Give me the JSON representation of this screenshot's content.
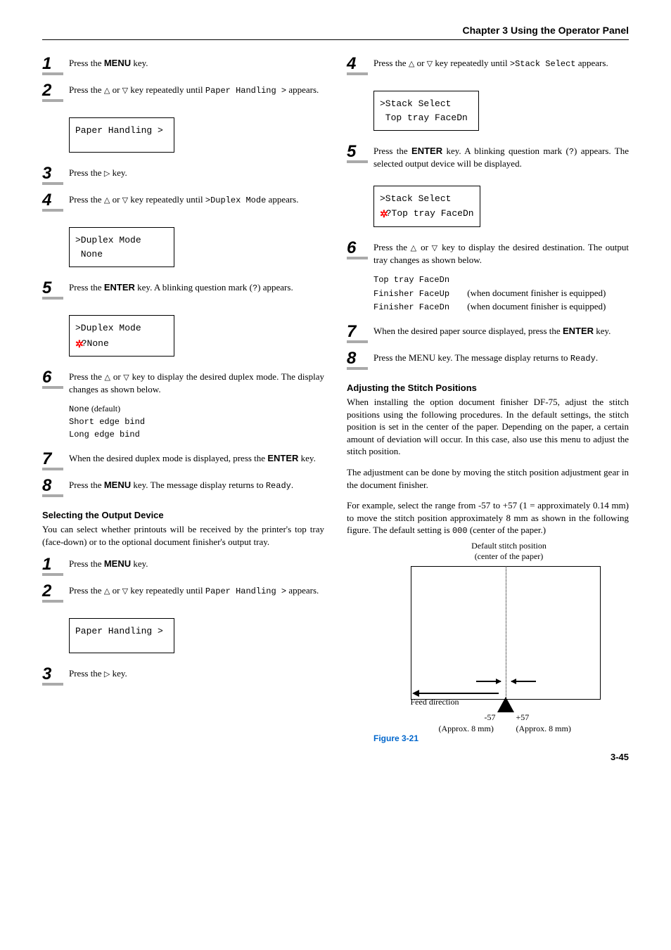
{
  "header": "Chapter 3  Using the Operator Panel",
  "left": {
    "s1": {
      "pre": "Press the ",
      "menu": "MENU",
      "post": " key."
    },
    "s2": {
      "pre": "Press the ",
      "mid": " or ",
      "post": " key repeatedly until ",
      "code": "Paper Handling >",
      "tail": " appears."
    },
    "lcd2": "Paper Handling >",
    "s3": {
      "pre": "Press the ",
      "post": " key."
    },
    "s4": {
      "pre": "Press the ",
      "mid": " or ",
      "post": " key repeatedly until ",
      "code": ">Duplex Mode",
      "tail": " appears."
    },
    "lcd4": ">Duplex Mode\n None",
    "s5": {
      "pre": "Press the ",
      "enter": "ENTER",
      "post": " key. A blinking question mark (",
      "q": "?",
      "tail": ") appears."
    },
    "lcd5_line1": ">Duplex Mode",
    "lcd5_line2": "?None",
    "s6": {
      "pre": "Press the ",
      "mid": " or ",
      "post": " key to display the desired duplex mode. The display changes as shown below."
    },
    "opt_none": "None",
    "opt_none_def": " (default)",
    "opt_short": "Short edge bind",
    "opt_long": "Long edge bind",
    "s7": {
      "pre": "When the desired duplex mode is displayed, press the ",
      "enter": "ENTER",
      "post": " key."
    },
    "s8": {
      "pre": "Press the ",
      "menu": "MENU",
      "post": " key. The message display returns to ",
      "code": "Ready",
      "tail": "."
    },
    "sec_head": "Selecting the Output Device",
    "sec_p": "You can select whether printouts will be received by the printer's top tray (face-down) or to the optional document finisher's output tray.",
    "b1": {
      "pre": "Press the ",
      "menu": "MENU",
      "post": " key."
    },
    "b2": {
      "pre": "Press the ",
      "mid": " or ",
      "post": " key repeatedly until ",
      "code": "Paper Handling >",
      "tail": " appears."
    },
    "blcd2": "Paper Handling >",
    "b3": {
      "pre": "Press the ",
      "post": " key."
    }
  },
  "right": {
    "s4": {
      "pre": "Press the ",
      "mid": " or ",
      "post": " key repeatedly until ",
      "code": ">Stack Select",
      "tail": " appears."
    },
    "lcd4": ">Stack Select\n Top tray FaceDn",
    "s5": {
      "pre": "Press the ",
      "enter": "ENTER",
      "post": " key. A blinking question mark (",
      "q": "?",
      "tail": ") appears. The selected output device will be displayed."
    },
    "lcd5_line1": ">Stack Select",
    "lcd5_line2": "?Top tray FaceDn",
    "s6": {
      "pre": "Press the ",
      "mid": " or ",
      "post": " key to display the desired destination. The output tray changes as shown below."
    },
    "opt_top": "Top tray FaceDn",
    "opt_fu": "Finisher FaceUp",
    "opt_fu_txt": " (when document finisher is equipped)",
    "opt_fd": "Finisher FaceDn",
    "opt_fd_txt": " (when document finisher is equipped)",
    "s7": {
      "pre": "When the desired paper source displayed, press the ",
      "enter": "ENTER",
      "post": " key."
    },
    "s8": {
      "pre": "Press the MENU key. The message display returns to ",
      "code": "Ready",
      "tail": "."
    },
    "sec_head": "Adjusting the Stitch Positions",
    "sec_p1": "When installing the option document finisher DF-75, adjust the stitch positions using the following procedures. In the default settings, the stitch position is set in the center of the paper. Depending on the paper, a certain amount of deviation will occur. In this case, also use this menu to adjust the stitch position.",
    "sec_p2": "The adjustment can be done by moving the stitch position adjustment gear in the document finisher.",
    "sec_p3_pre": "For example, select the range from -57 to +57 (1 = approximately 0.14 mm) to move the stitch position approximately 8 mm as shown in the following figure. The default setting is ",
    "sec_p3_code": "000",
    "sec_p3_post": " (center of the paper.)",
    "fig_top": "Default stitch position\n(center of the paper)",
    "fig_feed": "Feed direction",
    "fig_n57": "-57",
    "fig_p57": "+57",
    "fig_approxL": "(Approx. 8 mm)",
    "fig_approxR": "(Approx. 8 mm)",
    "fig_caption": "Figure 3-21"
  },
  "pagenum": "3-45"
}
